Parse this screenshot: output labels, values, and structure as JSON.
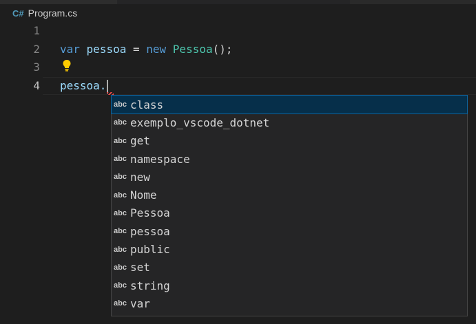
{
  "tab": {
    "icon": "C#",
    "filename": "Program.cs"
  },
  "editor": {
    "line_numbers": [
      "1",
      "2",
      "3",
      "4"
    ],
    "line2": {
      "kw_var": "var",
      "ident": "pessoa",
      "eq": " = ",
      "kw_new": "new",
      "type": "Pessoa",
      "end": "();"
    },
    "line4": {
      "text": "pessoa."
    }
  },
  "suggestions": {
    "kind_label": "abc",
    "selected_index": 0,
    "items": [
      "class",
      "exemplo_vscode_dotnet",
      "get",
      "namespace",
      "new",
      "Nome",
      "Pessoa",
      "pessoa",
      "public",
      "set",
      "string",
      "var"
    ]
  },
  "colors": {
    "background": "#1e1e1e",
    "keyword": "#569cd6",
    "type": "#4ec9b0",
    "identifier": "#9cdcfe",
    "selection": "#062f4a",
    "bulb": "#ffcc00"
  },
  "icons": {
    "lightbulb": "lightbulb-icon",
    "error": "error-squiggle"
  }
}
